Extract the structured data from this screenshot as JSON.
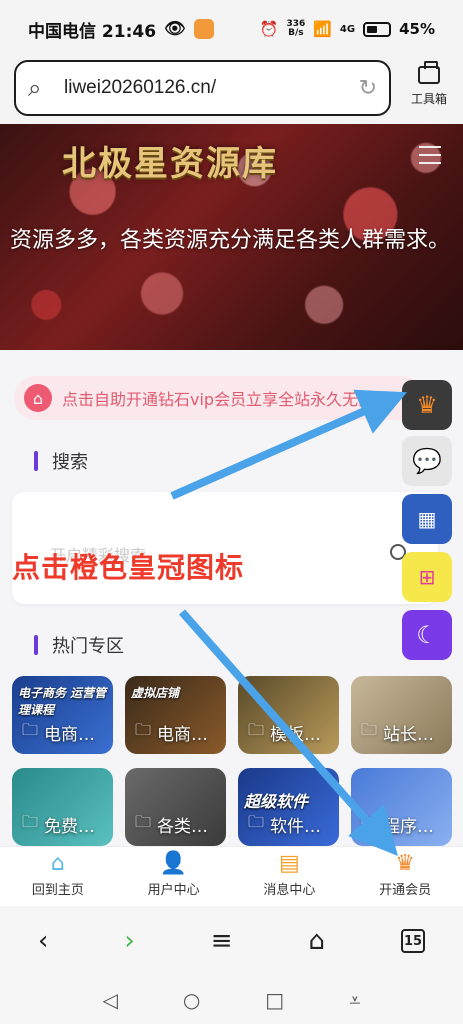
{
  "status_bar": {
    "carrier_time": "中国电信 21:46",
    "net_speed_value": "336",
    "net_speed_unit": "B/s",
    "network": "4G",
    "battery": "45%"
  },
  "browser": {
    "url": "liwei20260126.cn/",
    "toolbox_label": "工具箱"
  },
  "hero": {
    "title": "北极星资源库",
    "description": "资源多多，各类资源充分满足各类人群需求。"
  },
  "notice": {
    "text": "点击自助开通钻石vip会员立享全站永久无限"
  },
  "search_section": {
    "title": "搜索",
    "placeholder": "开启精彩搜索"
  },
  "annotation": {
    "text": "点击橙色皇冠图标"
  },
  "hot_section": {
    "title": "热门专区",
    "tiles": [
      {
        "label": "电商…",
        "banner": "电子商务 运营管理课程"
      },
      {
        "label": "电商…",
        "banner": "虚拟店铺"
      },
      {
        "label": "模板…",
        "banner": ""
      },
      {
        "label": "站长…",
        "banner": ""
      },
      {
        "label": "免费…",
        "banner": ""
      },
      {
        "label": "各类…",
        "banner": ""
      },
      {
        "label": "软件…",
        "banner": "超级软件"
      },
      {
        "label": "程序…",
        "banner": ""
      }
    ]
  },
  "bottom_nav": {
    "items": [
      {
        "label": "回到主页",
        "icon": "home-icon"
      },
      {
        "label": "用户中心",
        "icon": "user-icon"
      },
      {
        "label": "消息中心",
        "icon": "message-icon"
      },
      {
        "label": "开通会员",
        "icon": "crown-icon"
      }
    ]
  },
  "browser_toolbar": {
    "tab_count": "15"
  },
  "colors": {
    "accent_purple": "#6a3ad8",
    "notice_pink": "#e05a70",
    "annotation_red": "#ee3a2a",
    "arrow_blue": "#4aa3e8",
    "crown_orange": "#f28a2a"
  }
}
